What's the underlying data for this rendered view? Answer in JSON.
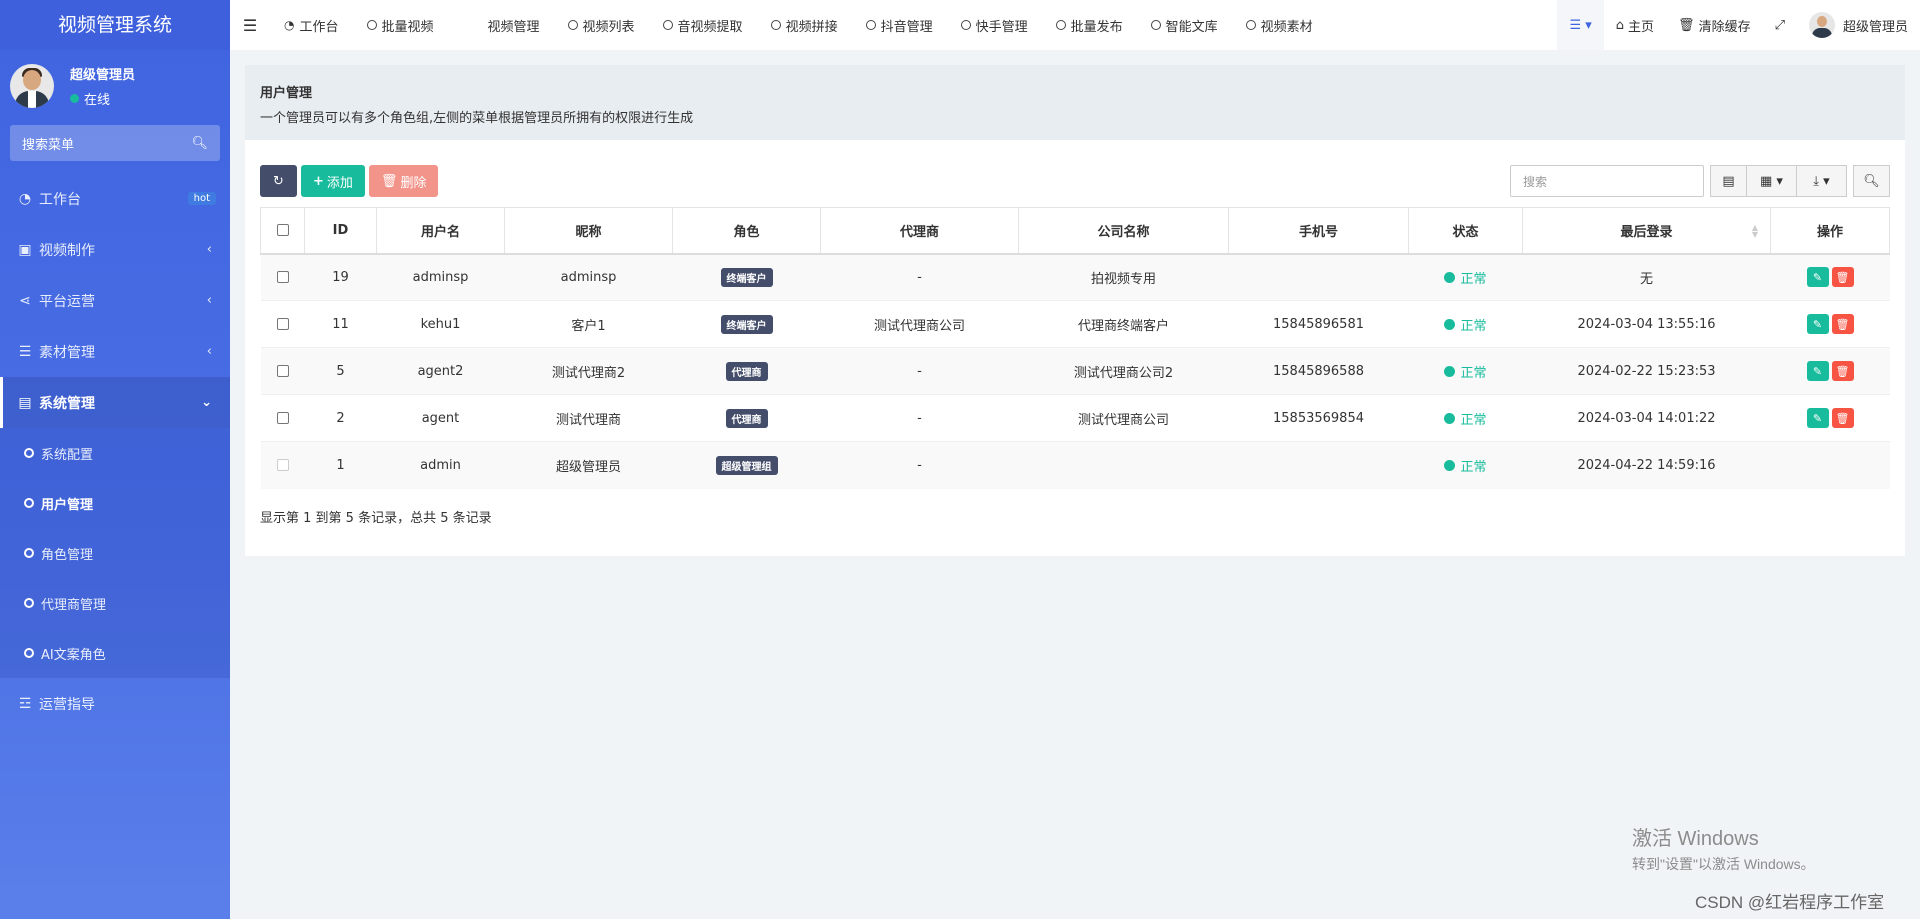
{
  "sidebar": {
    "brand": "视频管理系统",
    "user_name": "超级管理员",
    "user_status": "在线",
    "search_placeholder": "搜索菜单",
    "items": [
      {
        "label": "工作台",
        "icon": "dashboard-icon",
        "badge": "hot"
      },
      {
        "label": "视频制作",
        "icon": "video-icon"
      },
      {
        "label": "平台运营",
        "icon": "share-icon"
      },
      {
        "label": "素材管理",
        "icon": "layers-icon"
      },
      {
        "label": "系统管理",
        "icon": "desktop-icon"
      }
    ],
    "sub_items": [
      "系统配置",
      "用户管理",
      "角色管理",
      "代理商管理",
      "AI文案角色"
    ],
    "last_item": "运营指导"
  },
  "topbar": {
    "tabs": [
      "工作台",
      "批量视频",
      "视频管理",
      "视频列表",
      "音视频提取",
      "视频拼接",
      "抖音管理",
      "快手管理",
      "批量发布",
      "智能文库",
      "视频素材"
    ],
    "home": "主页",
    "clear_cache": "清除缓存",
    "admin": "超级管理员"
  },
  "panel": {
    "title": "用户管理",
    "desc": "一个管理员可以有多个角色组,左侧的菜单根据管理员所拥有的权限进行生成"
  },
  "toolbar": {
    "add": "添加",
    "delete": "删除",
    "search_placeholder": "搜索"
  },
  "table": {
    "headers": [
      "ID",
      "用户名",
      "昵称",
      "角色",
      "代理商",
      "公司名称",
      "手机号",
      "状态",
      "最后登录",
      "操作"
    ],
    "rows": [
      {
        "id": "19",
        "username": "adminsp",
        "nickname": "adminsp",
        "role": "终端客户",
        "agent": "-",
        "company": "拍视频专用",
        "phone": "",
        "status": "正常",
        "last_login": "无",
        "ops": true
      },
      {
        "id": "11",
        "username": "kehu1",
        "nickname": "客户1",
        "role": "终端客户",
        "agent": "测试代理商公司",
        "company": "代理商终端客户",
        "phone": "15845896581",
        "status": "正常",
        "last_login": "2024-03-04 13:55:16",
        "ops": true
      },
      {
        "id": "5",
        "username": "agent2",
        "nickname": "测试代理商2",
        "role": "代理商",
        "agent": "-",
        "company": "测试代理商公司2",
        "phone": "15845896588",
        "status": "正常",
        "last_login": "2024-02-22 15:23:53",
        "ops": true
      },
      {
        "id": "2",
        "username": "agent",
        "nickname": "测试代理商",
        "role": "代理商",
        "agent": "-",
        "company": "测试代理商公司",
        "phone": "15853569854",
        "status": "正常",
        "last_login": "2024-03-04 14:01:22",
        "ops": true
      },
      {
        "id": "1",
        "username": "admin",
        "nickname": "超级管理员",
        "role": "超级管理组",
        "agent": "-",
        "company": "",
        "phone": "",
        "status": "正常",
        "last_login": "2024-04-22 14:59:16",
        "ops": false
      }
    ],
    "footer": "显示第 1 到第 5 条记录，总共 5 条记录"
  },
  "watermark": {
    "line1": "激活 Windows",
    "line2": "转到\"设置\"以激活 Windows。",
    "csdn": "CSDN @红岩程序工作室"
  },
  "colors": {
    "sidebar": "#4064e0",
    "success": "#18bc9c",
    "danger": "#f75444",
    "dark": "#444e6b"
  }
}
